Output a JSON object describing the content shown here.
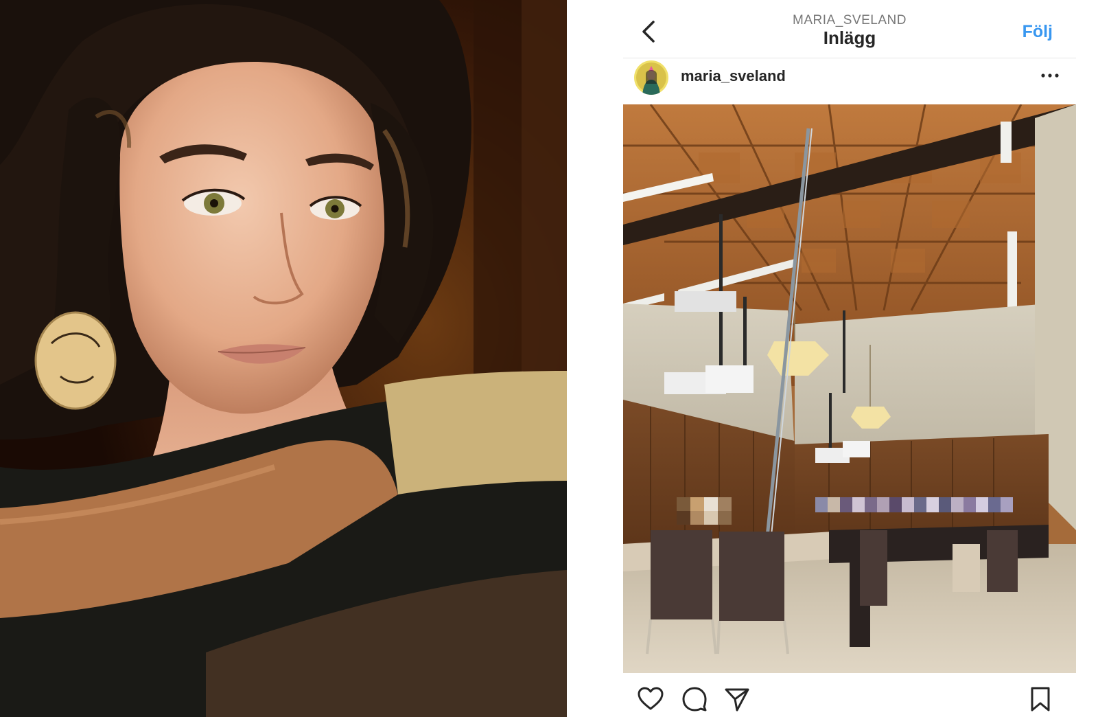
{
  "header": {
    "username": "MARIA_SVELAND",
    "title": "Inlägg",
    "follow_label": "Följ"
  },
  "post": {
    "username": "maria_sveland"
  },
  "icons": {
    "back": "chevron-left-icon",
    "more": "more-horizontal-icon",
    "like": "heart-icon",
    "comment": "comment-icon",
    "share": "paper-plane-icon",
    "save": "bookmark-icon"
  },
  "colors": {
    "accent": "#3897f0",
    "text": "#262626",
    "muted": "#777777"
  }
}
